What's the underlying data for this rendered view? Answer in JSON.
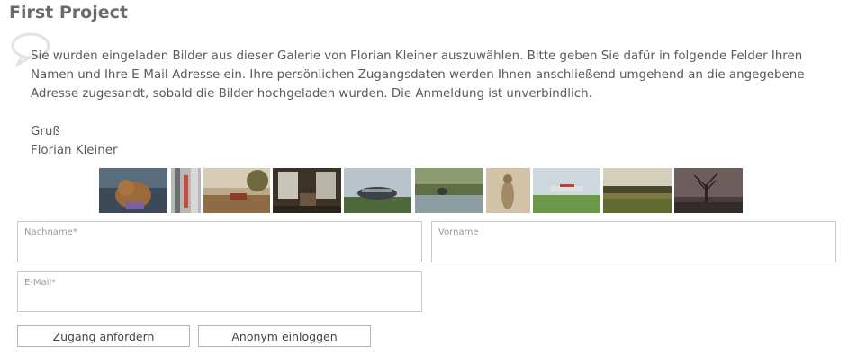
{
  "page": {
    "title": "First Project"
  },
  "message": {
    "icon": "speech-bubble-icon",
    "paragraph": "Sie wurden eingeladen Bilder aus dieser Galerie von Florian Kleiner auszuwählen. Bitte geben Sie dafür in folgende Felder Ihren Namen und Ihre E-Mail-Adresse ein. Ihre persönlichen Zugangsdaten werden Ihnen anschließend umgehend an die angegebene Adresse zugesandt, sobald die Bilder hochgeladen wurden. Die Anmeldung ist unverbindlich.",
    "greeting": "Gruß",
    "signature": "Florian Kleiner"
  },
  "gallery": {
    "thumbnails": [
      {
        "subject": "dog"
      },
      {
        "subject": "building-facade"
      },
      {
        "subject": "car-in-field"
      },
      {
        "subject": "interior-room"
      },
      {
        "subject": "stadium"
      },
      {
        "subject": "bird-on-water"
      },
      {
        "subject": "meerkat"
      },
      {
        "subject": "airplane"
      },
      {
        "subject": "field-trees"
      },
      {
        "subject": "bare-tree"
      }
    ]
  },
  "form": {
    "lastname": {
      "placeholder": "Nachname*",
      "value": ""
    },
    "firstname": {
      "placeholder": "Vorname",
      "value": ""
    },
    "email": {
      "placeholder": "E-Mail*",
      "value": ""
    },
    "request_button": "Zugang anfordern",
    "anonymous_button": "Anonym einloggen"
  }
}
